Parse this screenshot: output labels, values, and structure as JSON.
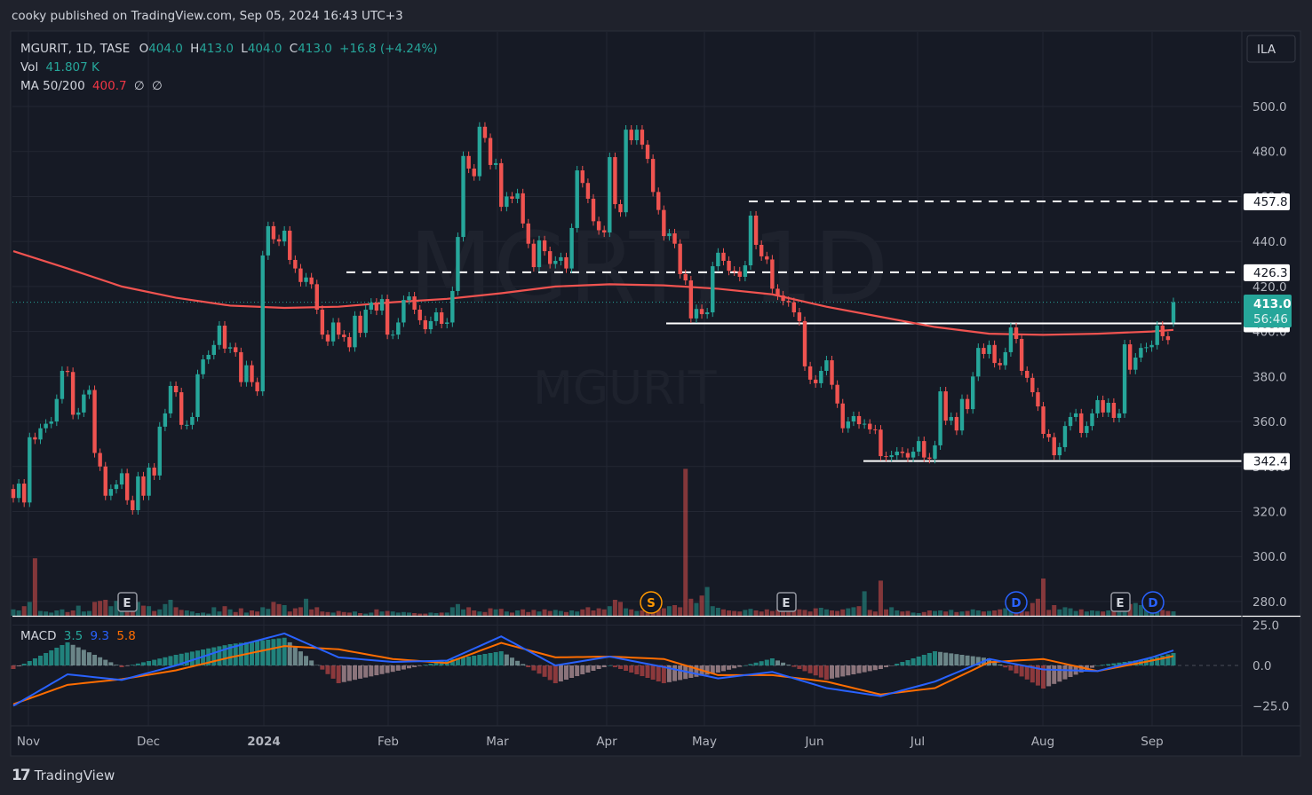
{
  "publish_line": "cooky published on TradingView.com, Sep 05, 2024 16:43 UTC+3",
  "footer": {
    "brand": "TradingView",
    "logo_glyph": "17"
  },
  "currency_button": "ILA",
  "legend": {
    "symbol": "MGURIT, 1D, TASE",
    "o_label": "O",
    "o": "404.0",
    "h_label": "H",
    "h": "413.0",
    "l_label": "L",
    "l": "404.0",
    "c_label": "C",
    "c": "413.0",
    "change": "+16.8 (+4.24%)",
    "vol_label": "Vol",
    "vol": "41.807 K",
    "ma_label": "MA 50/200",
    "ma_value": "400.7",
    "ma_na1": "∅",
    "ma_na2": "∅",
    "macd_label": "MACD",
    "macd_hist": "3.5",
    "macd_line": "9.3",
    "macd_signal": "5.8"
  },
  "watermark": {
    "top": "MGRT, 1D",
    "bottom": "MGURIT"
  },
  "last_price": {
    "value": "413.0",
    "countdown": "56:46"
  },
  "colors": {
    "up": "#26a69a",
    "down": "#ef5350",
    "ma": "#f05350",
    "macd": "#2962ff",
    "signal": "#ff6d00",
    "background": "#161a25",
    "level": "#ffffff",
    "event_d": "#2962ff"
  },
  "chart_data": {
    "type": "candlestick",
    "price_axis": {
      "ticks": [
        "500.0",
        "480.0",
        "460.0",
        "440.0",
        "420.0",
        "400.0",
        "380.0",
        "360.0",
        "340.0",
        "320.0",
        "300.0",
        "280.0"
      ],
      "ylim": [
        280,
        500
      ]
    },
    "time_axis": {
      "ticks": [
        "Nov",
        "Dec",
        "2024",
        "Feb",
        "Mar",
        "Apr",
        "May",
        "Jun",
        "Jul",
        "Aug",
        "Sep"
      ]
    },
    "last_open": 404.0,
    "closes": [
      326,
      332.4,
      324,
      353,
      352,
      357,
      359,
      360,
      370,
      382.5,
      382,
      363,
      364,
      372,
      374,
      346,
      340,
      327,
      330,
      332,
      337,
      325,
      320.6,
      335.6,
      327,
      339.5,
      336,
      357.7,
      363.6,
      375.8,
      373,
      358.5,
      358.5,
      362,
      381,
      387.6,
      389.6,
      394,
      402.6,
      392.4,
      393,
      390.8,
      377.5,
      385,
      377.5,
      373.4,
      433.8,
      446.8,
      441,
      440,
      444.8,
      431.8,
      428,
      422,
      424,
      421,
      409.7,
      398.6,
      395.6,
      404,
      398.6,
      397.5,
      393,
      407,
      399.4,
      409.7,
      412.8,
      409.3,
      414.4,
      398.6,
      398.6,
      404,
      414,
      415.6,
      409.7,
      405,
      401,
      404.6,
      408.5,
      403.4,
      404,
      418,
      442,
      478,
      472.4,
      469,
      491,
      486,
      474,
      474.8,
      455.4,
      460,
      459,
      461.4,
      448,
      439,
      428.6,
      440.5,
      435.7,
      430,
      431.4,
      433,
      428,
      446,
      471.6,
      466,
      459,
      449,
      445,
      444,
      477.5,
      456.6,
      453,
      489.7,
      485,
      489.7,
      483,
      476.7,
      462,
      454,
      442.4,
      443.6,
      439,
      425.5,
      422.7,
      405.8,
      410,
      407.7,
      408.5,
      429,
      435,
      431.4,
      427,
      426.7,
      424.3,
      429.4,
      451.5,
      438.5,
      433.4,
      432,
      419,
      416,
      413.6,
      413,
      408.5,
      404.6,
      384.5,
      378.6,
      377,
      382.5,
      387.2,
      376.3,
      368,
      357,
      360,
      362.4,
      358.8,
      359,
      356.5,
      356.4,
      344.6,
      344.2,
      345,
      346.6,
      346,
      344,
      346.6,
      351.3,
      344,
      343.4,
      349.4,
      373.4,
      360.4,
      362,
      356,
      370,
      365.5,
      380,
      392.7,
      390,
      394,
      386,
      385,
      390.8,
      401.8,
      396.7,
      382.5,
      379.4,
      373,
      366.7,
      354.5,
      353,
      345,
      348.6,
      358,
      362,
      363.6,
      354.9,
      358,
      363.6,
      369.5,
      364,
      368.3,
      361.6,
      363.6,
      394.3,
      383,
      388.4,
      392.7,
      393,
      394,
      402.6,
      397.9,
      396.2,
      413
    ],
    "volume_k": [
      60,
      50,
      90,
      130,
      540,
      45,
      40,
      30,
      50,
      60,
      35,
      50,
      95,
      40,
      45,
      130,
      140,
      150,
      90,
      140,
      70,
      40,
      60,
      130,
      95,
      90,
      45,
      60,
      110,
      150,
      80,
      55,
      50,
      40,
      25,
      30,
      20,
      80,
      40,
      90,
      60,
      35,
      70,
      30,
      50,
      40,
      80,
      65,
      130,
      110,
      100,
      40,
      70,
      80,
      160,
      60,
      80,
      40,
      35,
      30,
      45,
      35,
      30,
      40,
      25,
      20,
      30,
      60,
      40,
      45,
      40,
      30,
      35,
      30,
      25,
      20,
      20,
      30,
      25,
      30,
      30,
      80,
      110,
      60,
      80,
      50,
      40,
      35,
      70,
      60,
      65,
      40,
      30,
      50,
      60,
      35,
      55,
      40,
      60,
      45,
      55,
      45,
      35,
      50,
      40,
      60,
      80,
      50,
      70,
      60,
      90,
      150,
      130,
      70,
      60,
      45,
      50,
      100,
      55,
      60,
      70,
      90,
      100,
      80,
      1380,
      160,
      120,
      190,
      270,
      90,
      75,
      60,
      50,
      45,
      40,
      55,
      65,
      50,
      40,
      60,
      45,
      55,
      40,
      50,
      70,
      60,
      55,
      40,
      70,
      75,
      60,
      50,
      45,
      60,
      70,
      80,
      90,
      230,
      55,
      40,
      330,
      60,
      80,
      50,
      40,
      45,
      30,
      25,
      35,
      50,
      45,
      50,
      40,
      55,
      35,
      40,
      45,
      60,
      50,
      40,
      45,
      50,
      60,
      70,
      80,
      60,
      55,
      40,
      120,
      160,
      350,
      55,
      100,
      60,
      80,
      70,
      45,
      60,
      40,
      50,
      45,
      40,
      50,
      55,
      60,
      90,
      110,
      120,
      100,
      80,
      50,
      45,
      55,
      45,
      41.8
    ],
    "ma200_samples": [
      435.7,
      428,
      420,
      415,
      411.5,
      410.5,
      411,
      413,
      414.5,
      417,
      420,
      421,
      420.5,
      419,
      416.5,
      411,
      406.5,
      402,
      399,
      398.5,
      399,
      400,
      400.7
    ],
    "levels": [
      {
        "value": 457.8,
        "label": "457.8",
        "style": "dashed"
      },
      {
        "value": 426.3,
        "label": "426.3",
        "style": "dashed"
      },
      {
        "value": 403.6,
        "label": "403.6",
        "style": "solid"
      },
      {
        "value": 342.4,
        "label": "342.4",
        "style": "solid"
      }
    ],
    "events": [
      {
        "type": "E",
        "label": "E",
        "month": "Nov"
      },
      {
        "type": "S",
        "label": "S",
        "month": "Apr"
      },
      {
        "type": "E",
        "label": "E",
        "month": "May"
      },
      {
        "type": "D",
        "label": "D",
        "month": "Jul"
      },
      {
        "type": "E",
        "label": "E",
        "month": "Aug"
      },
      {
        "type": "D",
        "label": "D",
        "month": "Sep"
      }
    ],
    "macd": {
      "axis_ticks": [
        "25.0",
        "0.0",
        "−25.0"
      ],
      "ylim": [
        -30,
        30
      ],
      "macd_samples": [
        -25,
        -5.5,
        -9,
        0,
        11,
        19.8,
        5,
        2.2,
        3,
        18,
        0,
        5.5,
        -1,
        -8,
        -4,
        -14,
        -19,
        -10,
        4,
        -2.5,
        -3.5,
        5,
        9.3
      ],
      "signal_samples": [
        -24,
        -12,
        -8.5,
        -3,
        5,
        12,
        10,
        4,
        1.5,
        14,
        5,
        5.5,
        4,
        -6,
        -6,
        -10,
        -18,
        -14,
        2,
        4,
        -3.5,
        3,
        5.8
      ]
    }
  }
}
